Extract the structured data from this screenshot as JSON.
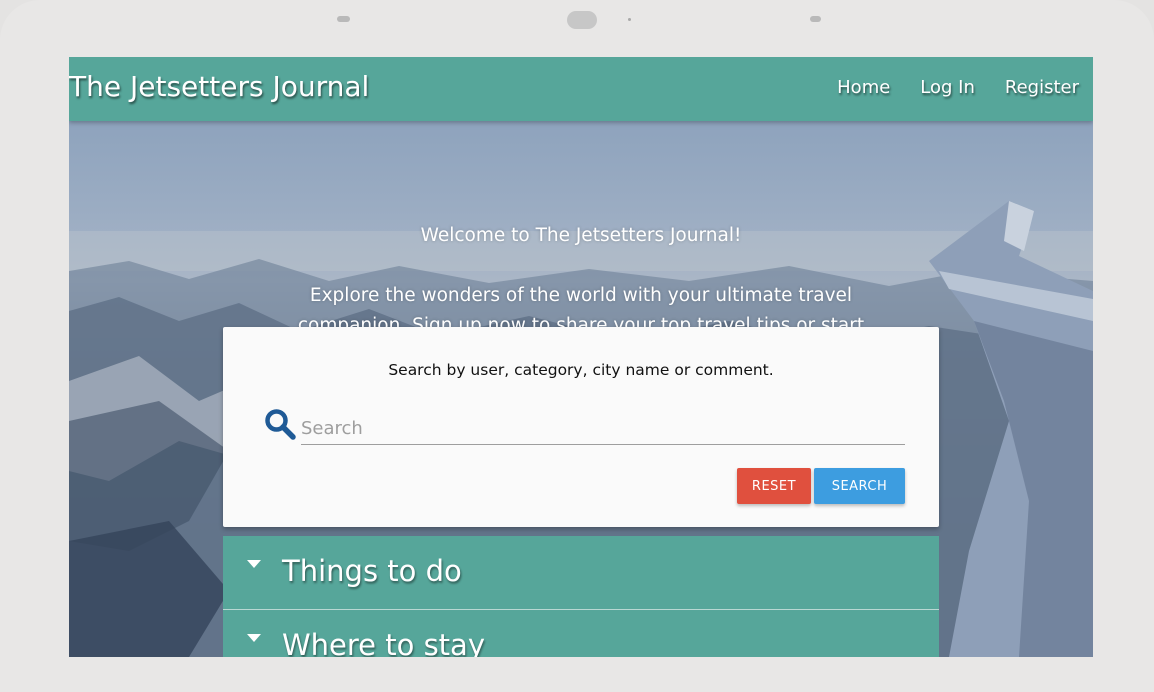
{
  "navbar": {
    "brand": "The Jetsetters Journal",
    "links": [
      "Home",
      "Log In",
      "Register"
    ]
  },
  "hero": {
    "welcome": "Welcome to The Jetsetters Journal!",
    "intro": "Explore the wonders of the world with your ultimate travel companion. Sign up now to share your top travel tips or start searching for recommendations below without an account."
  },
  "search": {
    "prompt": "Search by user, category, city name or comment.",
    "placeholder": "Search",
    "value": "",
    "reset_label": "RESET",
    "search_label": "SEARCH",
    "icon": "search-icon"
  },
  "accordion": {
    "items": [
      "Things to do",
      "Where to stay"
    ]
  },
  "colors": {
    "navbar": "#56a69a",
    "reset": "#e0503e",
    "search": "#3d9de0",
    "icon": "#1f5a96"
  }
}
